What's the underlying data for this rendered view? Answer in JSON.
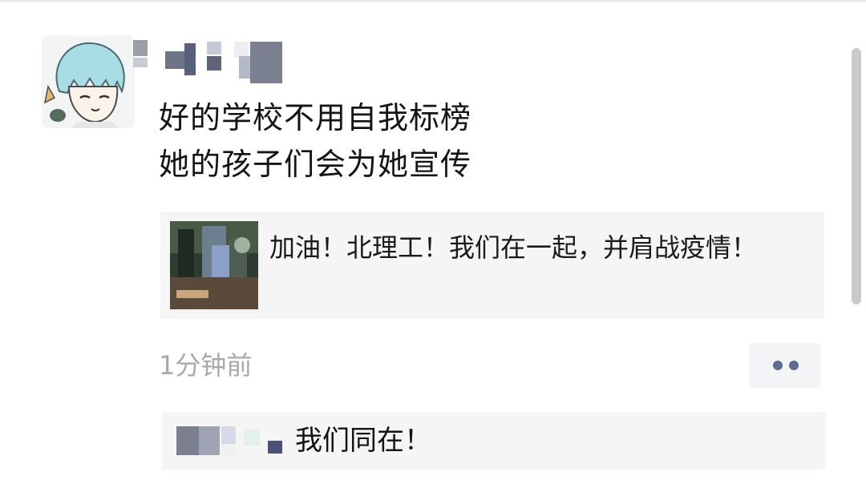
{
  "post": {
    "author_avatar_icon": "anime-character-avatar",
    "author_name_obscured": true,
    "text_lines": [
      "好的学校不用自我标榜",
      "她的孩子们会为她宣传"
    ],
    "shared_link": {
      "thumbnail_icon": "campus-photo-thumbnail",
      "title": "加油！北理工！我们在一起，并肩战疫情！"
    },
    "timestamp": "1分钟前",
    "more_icon": "more-dots-icon"
  },
  "comments": [
    {
      "author_name_obscured": true,
      "text": "我们同在！"
    }
  ],
  "colors": {
    "link_blue": "#5a6b94",
    "card_bg": "#f5f5f5",
    "timestamp_gray": "#a9a9a9"
  }
}
